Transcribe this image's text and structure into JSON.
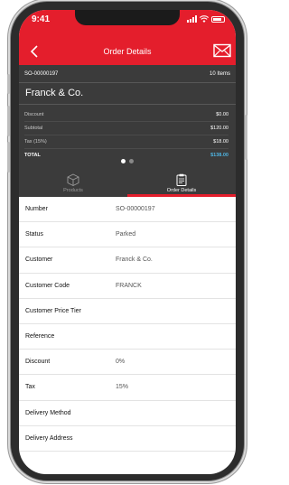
{
  "status_bar": {
    "time": "9:41"
  },
  "header": {
    "title": "Order Details"
  },
  "summary": {
    "order_number": "SO-00000197",
    "item_count": "10 Items",
    "customer_name": "Franck & Co.",
    "totals": [
      {
        "label": "Discount",
        "value": "$0.00"
      },
      {
        "label": "Subtotal",
        "value": "$120.00"
      },
      {
        "label": "Tax (15%)",
        "value": "$18.00"
      },
      {
        "label": "TOTAL",
        "value": "$138.00"
      }
    ]
  },
  "tabs": [
    {
      "label": "Products",
      "icon": "box-icon"
    },
    {
      "label": "Order Details",
      "icon": "clipboard-icon"
    }
  ],
  "details": [
    {
      "label": "Number",
      "value": "SO-00000197"
    },
    {
      "label": "Status",
      "value": "Parked"
    },
    {
      "label": "Customer",
      "value": "Franck & Co."
    },
    {
      "label": "Customer Code",
      "value": "FRANCK"
    },
    {
      "label": "Customer Price Tier",
      "value": ""
    },
    {
      "label": "Reference",
      "value": ""
    },
    {
      "label": "Discount",
      "value": "0%"
    },
    {
      "label": "Tax",
      "value": "15%"
    },
    {
      "label": "Delivery Method",
      "value": ""
    },
    {
      "label": "Delivery Address",
      "value": ""
    }
  ],
  "colors": {
    "brand_red": "#e41e2c",
    "panel_dark": "#3b3b3b",
    "total_accent": "#4fb3e0"
  }
}
